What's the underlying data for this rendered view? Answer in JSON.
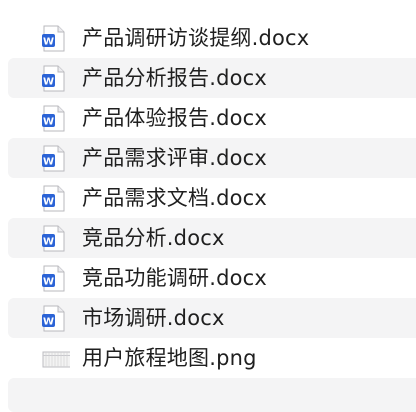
{
  "files": [
    {
      "name": "产品调研访谈提纲.docx",
      "icon": "word-document-icon"
    },
    {
      "name": "产品分析报告.docx",
      "icon": "word-document-icon"
    },
    {
      "name": "产品体验报告.docx",
      "icon": "word-document-icon"
    },
    {
      "name": "产品需求评审.docx",
      "icon": "word-document-icon"
    },
    {
      "name": "产品需求文档.docx",
      "icon": "word-document-icon"
    },
    {
      "name": "竞品分析.docx",
      "icon": "word-document-icon"
    },
    {
      "name": "竞品功能调研.docx",
      "icon": "word-document-icon"
    },
    {
      "name": "市场调研.docx",
      "icon": "word-document-icon"
    },
    {
      "name": "用户旅程地图.png",
      "icon": "png-image-icon"
    }
  ],
  "colors": {
    "stripe": "#f4f4f5",
    "word_blue": "#2b63d6",
    "text": "#1f1f1f"
  }
}
